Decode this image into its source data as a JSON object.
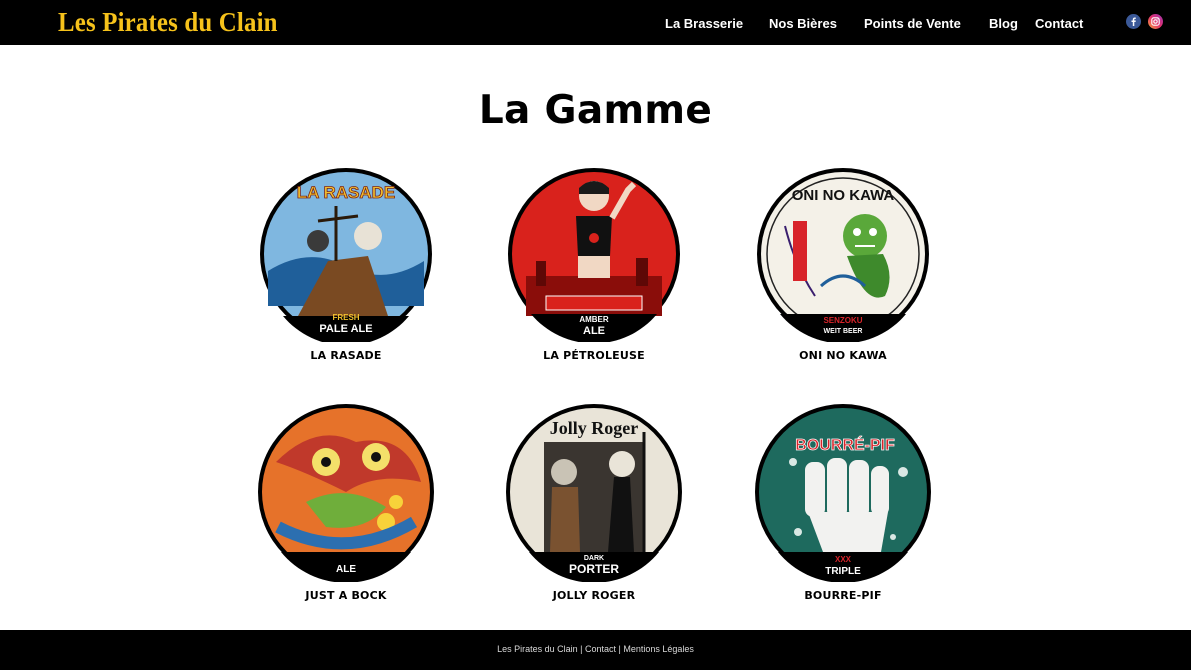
{
  "header": {
    "logo_text": "Les Pirates du Clain",
    "nav": [
      {
        "label": "La Brasserie"
      },
      {
        "label": "Nos Bières"
      },
      {
        "label": "Points de Vente"
      },
      {
        "label": "Blog"
      },
      {
        "label": "Contact"
      }
    ],
    "social": [
      {
        "icon": "facebook-icon",
        "color": "#3b5998"
      },
      {
        "icon": "instagram-icon",
        "color": "#d6249f"
      }
    ]
  },
  "main": {
    "title": "La Gamme",
    "beers": [
      {
        "name": "LA RASADE",
        "badge": {
          "top": "LA RASADE",
          "bottom_small": "FRESH",
          "bottom_big": "PALE ALE",
          "bg": "#f2c12e",
          "accent": "#1f7fbf"
        }
      },
      {
        "name": "LA PÉTROLEUSE",
        "badge": {
          "top": "",
          "bottom_small": "AMBER",
          "bottom_big": "ALE",
          "bg": "#d9221c",
          "accent": "#8a0d0a"
        }
      },
      {
        "name": "ONI NO KAWA",
        "badge": {
          "top": "ONI NO KAWA",
          "bottom_small": "SENZOKU",
          "bottom_big": "WEIT BEER",
          "bg": "#f4f1e8",
          "accent": "#3e8a2c"
        }
      },
      {
        "name": "JUST A BOCK",
        "badge": {
          "top": "",
          "bottom_small": "",
          "bottom_big": "ALE",
          "bg": "#e6722a",
          "accent": "#2c6fb0"
        }
      },
      {
        "name": "JOLLY ROGER",
        "badge": {
          "top": "Jolly Roger",
          "bottom_small": "DARK",
          "bottom_big": "PORTER",
          "bg": "#3a3530",
          "accent": "#c9c3b5"
        }
      },
      {
        "name": "BOURRE-PIF",
        "badge": {
          "top": "BOURRÉ-PIF",
          "bottom_small": "XXX",
          "bottom_big": "TRIPLE",
          "bg": "#1e6a5e",
          "accent": "#d8242a"
        }
      }
    ]
  },
  "footer": {
    "site_name": "Les Pirates du Clain",
    "separator": "|",
    "contact": "Contact",
    "legal": "Mentions Légales"
  }
}
